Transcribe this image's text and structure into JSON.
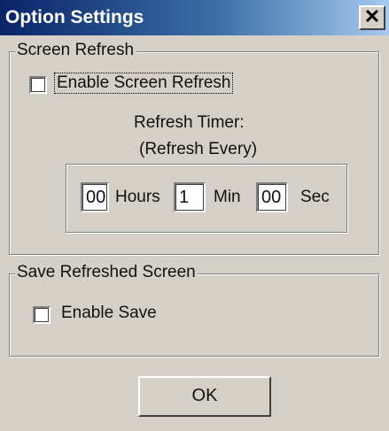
{
  "window": {
    "title": "Option Settings",
    "close_glyph": "✕"
  },
  "screen_refresh": {
    "group_label": "Screen Refresh",
    "enable_label": "Enable Screen Refresh",
    "enable_checked": false,
    "timer_label": "Refresh Timer:",
    "timer_sublabel": "(Refresh Every)",
    "hours_value": "00",
    "hours_label": "Hours",
    "min_value": "1",
    "min_label": "Min",
    "sec_value": "00",
    "sec_label": "Sec"
  },
  "save_refreshed": {
    "group_label": "Save Refreshed Screen",
    "enable_label": "Enable Save",
    "enable_checked": false
  },
  "buttons": {
    "ok_label": "OK"
  },
  "colors": {
    "title_gradient_start": "#0a246a",
    "title_gradient_end": "#a6caf0",
    "dialog_face": "#d4d0c8"
  }
}
